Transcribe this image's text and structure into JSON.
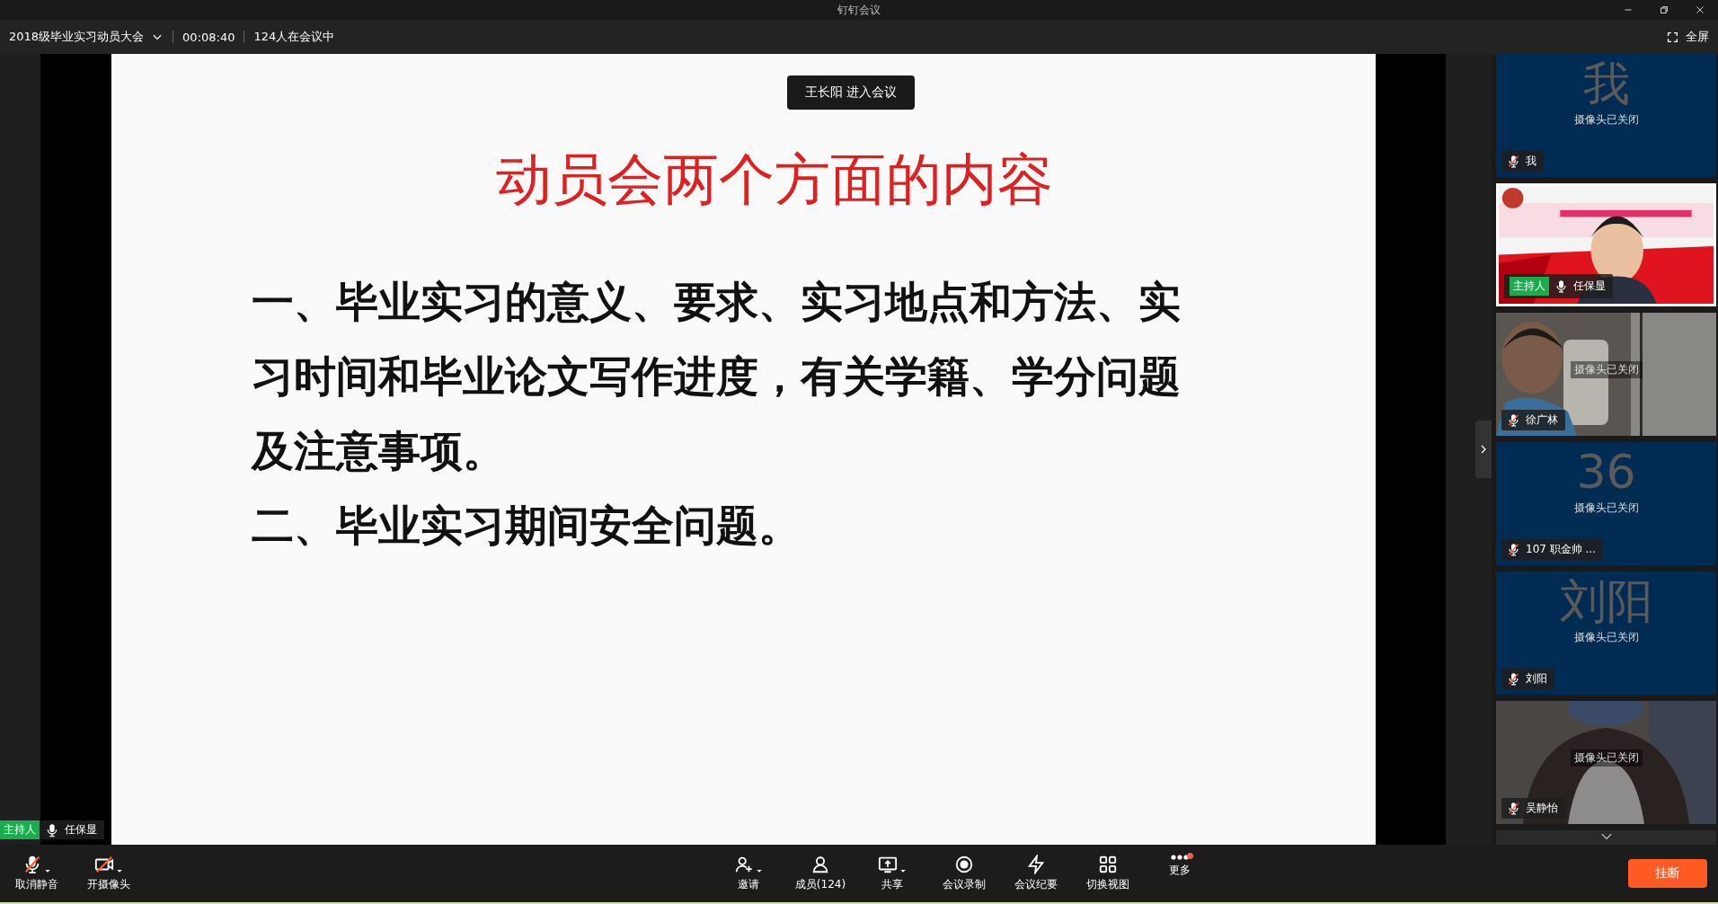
{
  "window": {
    "title": "钉钉会议"
  },
  "info_bar": {
    "meeting_name": "2018级毕业实习动员大会",
    "duration": "00:08:40",
    "attendance": "124人在会议中",
    "fullscreen": "全屏"
  },
  "toast": "王长阳 进入会议",
  "slide": {
    "title": "动员会两个方面的内容",
    "paragraphs": [
      "一、毕业实习的意义、要求、实习地点和方法、实习时间和毕业论文写作进度，有关学籍、学分问题及注意事项。",
      "二、毕业实习期间安全问题。"
    ]
  },
  "speaker": {
    "badge": "主持人",
    "name": "任保显",
    "muted": false
  },
  "participants": [
    {
      "kind": "avatar",
      "avatar_text": "我",
      "status": "摄像头已关闭",
      "name": "我",
      "muted": true
    },
    {
      "kind": "video",
      "badge": "主持人",
      "name": "任保显",
      "muted": false
    },
    {
      "kind": "picture",
      "status": "摄像头已关闭",
      "name": "徐广林",
      "muted": true
    },
    {
      "kind": "avatar",
      "avatar_text": "36",
      "status": "摄像头已关闭",
      "name": "107 职金帅 ...",
      "muted": true
    },
    {
      "kind": "avatar",
      "avatar_text": "刘阳",
      "status": "摄像头已关闭",
      "name": "刘阳",
      "muted": true
    },
    {
      "kind": "picture",
      "status": "摄像头已关闭",
      "name": "吴静怡",
      "muted": true
    }
  ],
  "toolbar": {
    "left": [
      {
        "kind": "mic",
        "label": "取消静音",
        "muted": true
      },
      {
        "kind": "camera",
        "label": "开摄像头",
        "muted": true
      }
    ],
    "center": [
      {
        "kind": "invite",
        "label": "邀请",
        "caret": true,
        "dot": false
      },
      {
        "kind": "members",
        "label": "成员(124)",
        "caret": false,
        "dot": false
      },
      {
        "kind": "share",
        "label": "共享",
        "caret": true,
        "dot": false
      },
      {
        "kind": "record",
        "label": "会议录制",
        "caret": false,
        "dot": false
      },
      {
        "kind": "minutes",
        "label": "会议纪要",
        "caret": false,
        "dot": false
      },
      {
        "kind": "view",
        "label": "切换视图",
        "caret": false,
        "dot": false
      },
      {
        "kind": "more",
        "label": "更多",
        "caret": false,
        "dot": true
      }
    ],
    "hangup": "挂断"
  }
}
